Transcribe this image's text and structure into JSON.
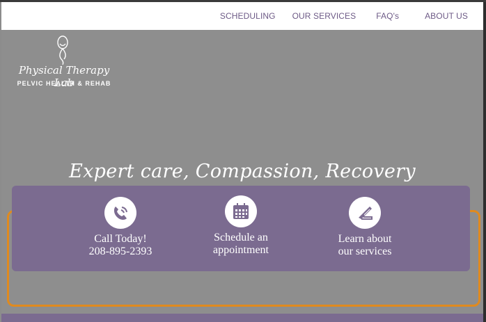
{
  "nav": {
    "items": [
      "SCHEDULING",
      "OUR SERVICES",
      "FAQ's",
      "ABOUT US"
    ]
  },
  "logo": {
    "script": "Physical Therapy Lab",
    "subtitle": "PELVIC HEALTH & REHAB"
  },
  "hero": {
    "tagline": "Expert care, Compassion, Recovery"
  },
  "cta": {
    "call": {
      "line1": "Call Today!",
      "line2": "208-895-2393",
      "icon": "phone-icon"
    },
    "schedule": {
      "line1": "Schedule an",
      "line2": "appointment",
      "icon": "calendar-icon"
    },
    "services": {
      "line1": "Learn about",
      "line2": "our services",
      "icon": "treatment-table-icon"
    }
  },
  "colors": {
    "accent": "#7b6b90",
    "outline": "#e08a1e",
    "nav_text": "#6d5a86",
    "hero_bg": "#8e8e8e"
  }
}
